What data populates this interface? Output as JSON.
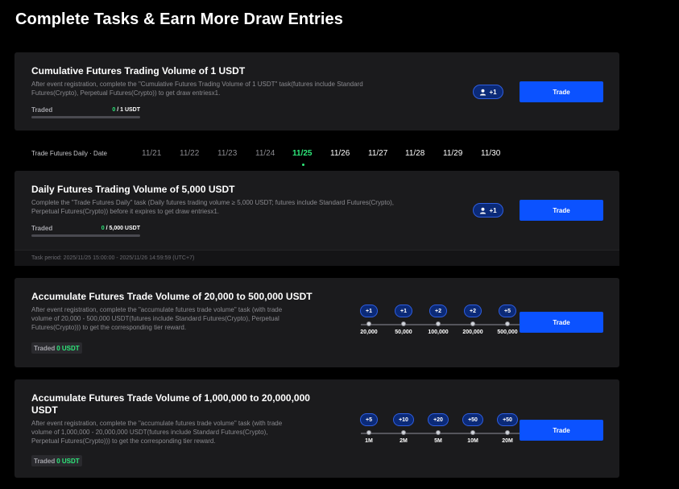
{
  "page": {
    "title": "Complete Tasks & Earn More Draw Entries"
  },
  "task1": {
    "title": "Cumulative Futures Trading Volume of 1 USDT",
    "desc_line1": "After event registration, complete the \"Cumulative Futures Trading Volume of 1 USDT\" task(futures include Standard",
    "desc_line2": "Futures(Crypto), Perpetual Futures(Crypto)) to get draw entriesx1.",
    "progress_label": "Traded",
    "progress_current": "0",
    "progress_target": " / 1 USDT",
    "progress_fraction": 0,
    "badge": "+1",
    "button": "Trade"
  },
  "dates": {
    "label": "Trade Futures Daily · Date",
    "items": [
      "11/21",
      "11/22",
      "11/23",
      "11/24",
      "11/25",
      "11/26",
      "11/27",
      "11/28",
      "11/29",
      "11/30"
    ],
    "active": "11/25"
  },
  "task2": {
    "title": "Daily Futures Trading Volume of 5,000 USDT",
    "desc_line1": "Complete the \"Trade Futures Daily\" task (Daily futures trading volume ≥ 5,000 USDT; futures include Standard Futures(Crypto),",
    "desc_line2": "Perpetual Futures(Crypto)) before it expires to get draw entriesx1.",
    "progress_label": "Traded",
    "progress_current": "0",
    "progress_target": " / 5,000 USDT",
    "progress_fraction": 0,
    "badge": "+1",
    "button": "Trade",
    "period": "Task period: 2025/11/25 15:00:00 - 2025/11/26 14:59:59 (UTC+7)"
  },
  "task3": {
    "title": "Accumulate Futures Trade Volume of 20,000 to 500,000 USDT",
    "desc_line1": "After event registration, complete the \"accumulate futures trade volume\" task (with trade",
    "desc_line2": "volume of 20,000 - 500,000 USDT(futures include Standard Futures(Crypto), Perpetual",
    "desc_line3": "Futures(Crypto))) to get the corresponding tier reward.",
    "traded_label": "Traded",
    "traded_value": "0 USDT",
    "tiers": [
      {
        "badge": "+1",
        "label": "20,000"
      },
      {
        "badge": "+1",
        "label": "50,000"
      },
      {
        "badge": "+2",
        "label": "100,000"
      },
      {
        "badge": "+2",
        "label": "200,000"
      },
      {
        "badge": "+5",
        "label": "500,000"
      }
    ],
    "button": "Trade"
  },
  "task4": {
    "title_line1": "Accumulate Futures Trade Volume of 1,000,000 to 20,000,000",
    "title_line2": "USDT",
    "desc_line1": "After event registration, complete the \"accumulate futures trade volume\" task (with trade",
    "desc_line2": "volume of 1,000,000 - 20,000,000 USDT(futures include Standard Futures(Crypto),",
    "desc_line3": "Perpetual Futures(Crypto))) to get the corresponding tier reward.",
    "traded_label": "Traded",
    "traded_value": "0 USDT",
    "tiers": [
      {
        "badge": "+5",
        "label": "1M"
      },
      {
        "badge": "+10",
        "label": "2M"
      },
      {
        "badge": "+20",
        "label": "5M"
      },
      {
        "badge": "+50",
        "label": "10M"
      },
      {
        "badge": "+50",
        "label": "20M"
      }
    ],
    "button": "Trade"
  },
  "icons": {
    "entry_badge": "user-icon"
  },
  "colors": {
    "accent": "#0b52ff",
    "green": "#2ee87a",
    "card": "#1b1b1d",
    "badge": "#0b2a78"
  }
}
